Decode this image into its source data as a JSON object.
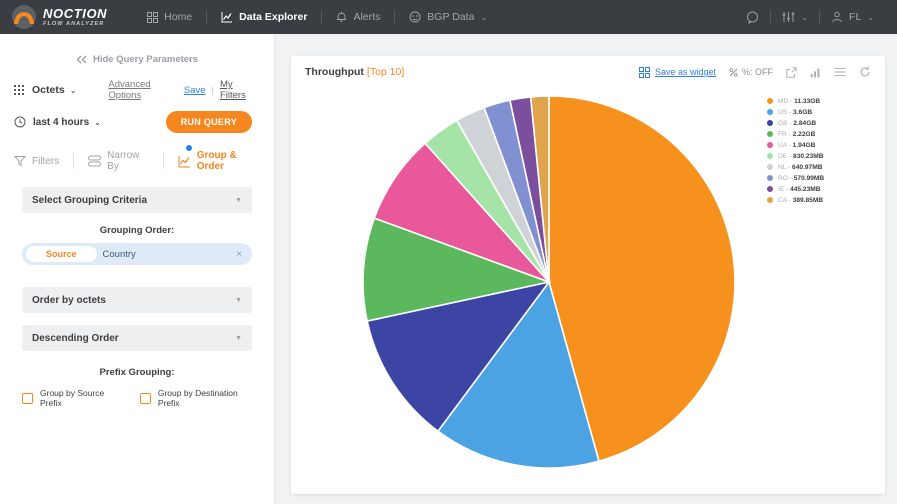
{
  "navbar": {
    "brand_name": "NOCTION",
    "brand_sub": "FLOW ANALYZER",
    "items": [
      {
        "label": "Home",
        "icon": "grid-icon",
        "active": false
      },
      {
        "label": "Data Explorer",
        "icon": "line-chart-icon",
        "active": true
      },
      {
        "label": "Alerts",
        "icon": "bell-icon",
        "active": false
      },
      {
        "label": "BGP Data",
        "icon": "bgp-icon",
        "active": false,
        "caret": "⌄"
      }
    ],
    "right": {
      "chat_icon": "chat-icon",
      "settings_icon": "sliders-icon",
      "user_icon": "user-icon",
      "user_initials": "FL",
      "caret": "⌄"
    }
  },
  "sidebar": {
    "hide_params": "Hide Query Parameters",
    "metric": "Octets",
    "advanced_options": "Advanced Options",
    "save": "Save",
    "separator": "|",
    "my_filters": "My Filters",
    "time_range": "last 4 hours",
    "run_query": "RUN QUERY",
    "tabs": [
      {
        "label": "Filters",
        "icon": "funnel-icon",
        "active": false,
        "badge": false
      },
      {
        "label": "Narrow By",
        "icon": "rows-icon",
        "active": false,
        "badge": false
      },
      {
        "label": "Group & Order",
        "icon": "group-chart-icon",
        "active": true,
        "badge": true
      }
    ],
    "grouping": {
      "criteria_placeholder": "Select Grouping Criteria",
      "grouping_order_title": "Grouping Order:",
      "pill_chip": "Source",
      "pill_text": "Country",
      "pill_close": "×",
      "order_by": "Order by octets",
      "direction": "Descending Order"
    },
    "prefix": {
      "title": "Prefix Grouping:",
      "options": [
        {
          "label": "Group by Source Prefix",
          "checked": false
        },
        {
          "label": "Group by Destination Prefix",
          "checked": false
        }
      ]
    }
  },
  "card": {
    "title": "Throughput",
    "title_suffix": "[Top 10]",
    "save_as_widget": "Save as widget",
    "percent_toggle": "%: OFF",
    "percent_icon": "percent-icon",
    "icons": [
      {
        "name": "external-link-icon"
      },
      {
        "name": "bar-chart-icon"
      },
      {
        "name": "list-menu-icon"
      },
      {
        "name": "refresh-icon"
      }
    ]
  },
  "chart_data": {
    "type": "pie",
    "title": "Throughput [Top 10]",
    "legend_position": "right",
    "unit": "bytes",
    "categories": [
      "MD",
      "US",
      "GB",
      "FR",
      "UA",
      "DE",
      "NL",
      "RO",
      "IE",
      "CA"
    ],
    "labels": [
      "MD - 11.33GB",
      "US - 3.6GB",
      "GB - 2.84GB",
      "FR - 2.22GB",
      "UA - 1.94GB",
      "DE - 830.23MB",
      "NL - 640.97MB",
      "RO - 570.99MB",
      "IE - 445.23MB",
      "CA - 389.85MB"
    ],
    "values": [
      11330,
      3600,
      2840,
      2220,
      1940,
      830.23,
      640.97,
      570.99,
      445.23,
      389.85
    ],
    "value_texts": [
      "11.33GB",
      "3.6GB",
      "2.84GB",
      "2.22GB",
      "1.94GB",
      "830.23MB",
      "640.97MB",
      "570.99MB",
      "445.23MB",
      "389.85MB"
    ],
    "colors": [
      "#f7911e",
      "#4ba3e3",
      "#3c44a4",
      "#5cb85c",
      "#e8589b",
      "#a6e3a6",
      "#cfd2d6",
      "#8190d0",
      "#7b4f9d",
      "#e0a44c"
    ]
  },
  "theme": {
    "accent": "#f6861f",
    "link": "#2f80ed",
    "navbar_bg": "#3a3d42",
    "canvas_bg": "#f1f2f4"
  }
}
